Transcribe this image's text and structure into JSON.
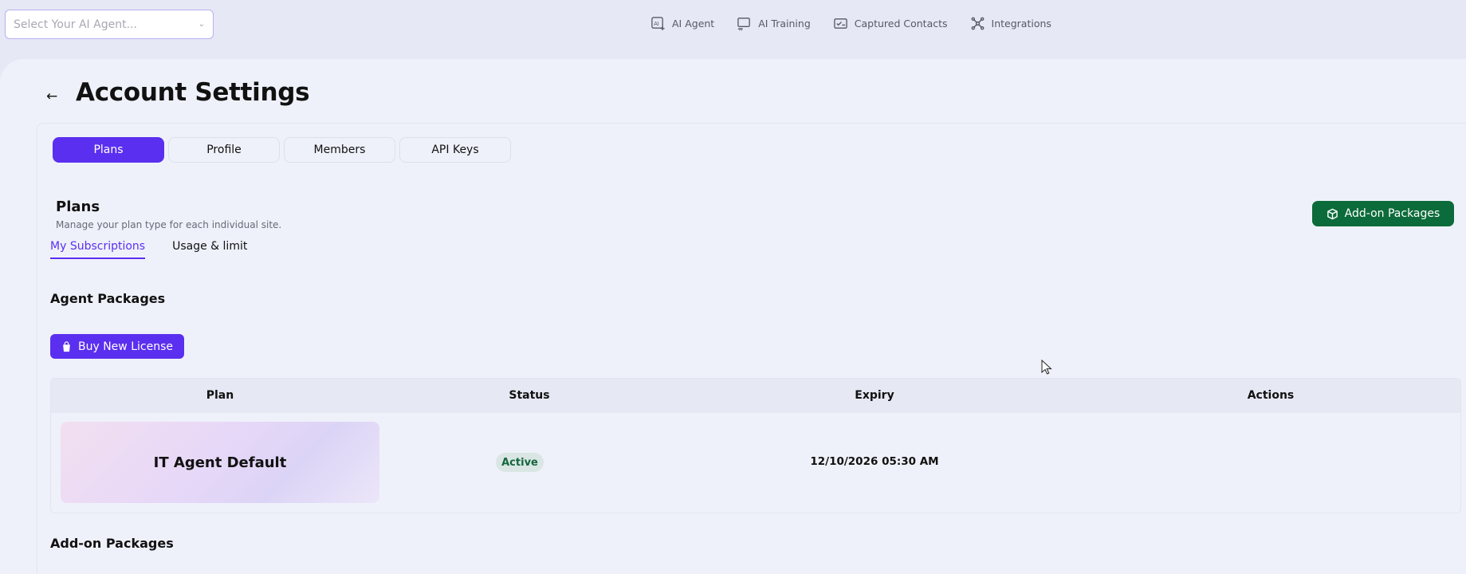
{
  "topbar": {
    "agent_select_placeholder": "Select Your AI Agent...",
    "nav": [
      {
        "label": "AI Agent",
        "icon": "ai-agent-icon"
      },
      {
        "label": "AI Training",
        "icon": "ai-training-icon"
      },
      {
        "label": "Captured Contacts",
        "icon": "contacts-icon"
      },
      {
        "label": "Integrations",
        "icon": "integrations-icon"
      }
    ]
  },
  "page": {
    "title": "Account Settings"
  },
  "tabs": [
    "Plans",
    "Profile",
    "Members",
    "API Keys"
  ],
  "active_tab": "Plans",
  "plans": {
    "title": "Plans",
    "description": "Manage your plan type for each individual site.",
    "addon_button": "Add-on Packages",
    "subtabs": [
      "My Subscriptions",
      "Usage & limit"
    ],
    "active_subtab": "My Subscriptions",
    "agent_packages_title": "Agent Packages",
    "buy_button": "Buy New License",
    "table": {
      "headers": [
        "Plan",
        "Status",
        "Expiry",
        "Actions"
      ],
      "rows": [
        {
          "plan": "IT Agent Default",
          "status": "Active",
          "expiry": "12/10/2026 05:30 AM",
          "actions": ""
        }
      ]
    },
    "addon_packages_title": "Add-on Packages"
  },
  "colors": {
    "accent": "#5b2ff0",
    "addon_green": "#0c6b3a",
    "active_badge_text": "#14663f"
  }
}
